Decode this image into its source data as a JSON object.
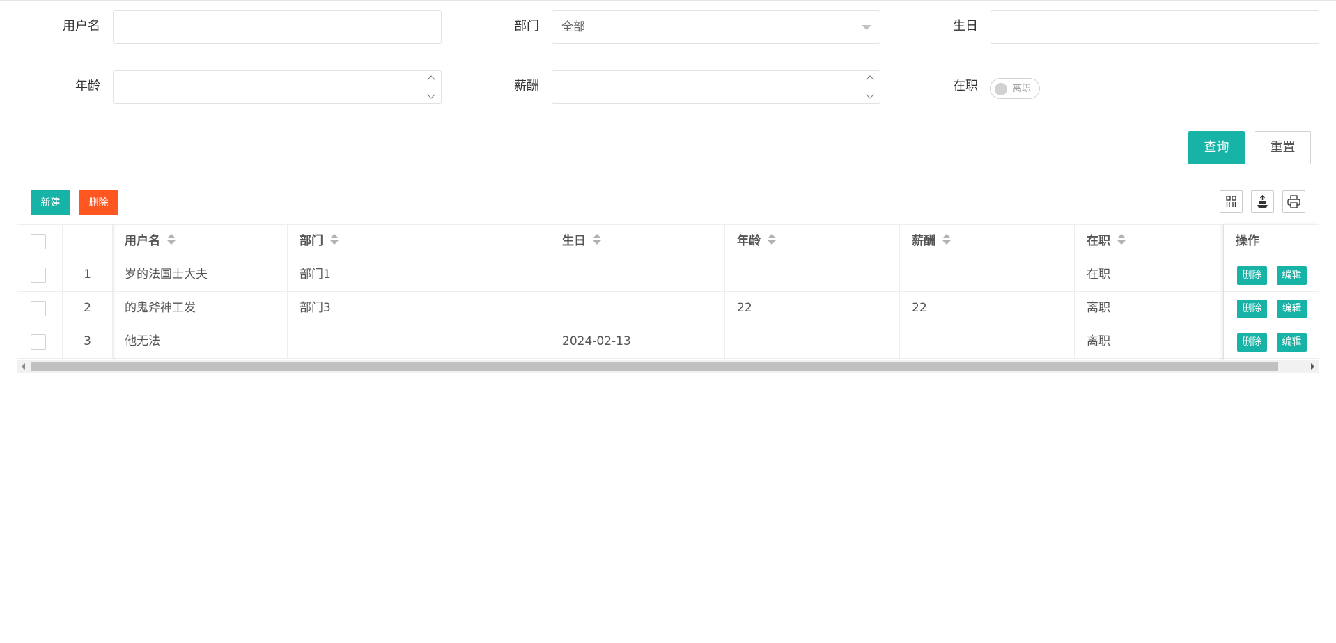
{
  "filters": {
    "username_label": "用户名",
    "username_value": "",
    "dept_label": "部门",
    "dept_value": "全部",
    "birthday_label": "生日",
    "birthday_value": "",
    "age_label": "年龄",
    "age_value": "",
    "salary_label": "薪酬",
    "salary_value": "",
    "employed_label": "在职",
    "employed_switch_text": "离职",
    "employed_on": false
  },
  "actions": {
    "query_label": "查询",
    "reset_label": "重置"
  },
  "toolbar": {
    "new_label": "新建",
    "delete_label": "删除",
    "icons": [
      "columns-icon",
      "export-icon",
      "print-icon"
    ]
  },
  "table": {
    "columns": [
      "用户名",
      "部门",
      "生日",
      "年龄",
      "薪酬",
      "在职",
      "操作"
    ],
    "rows": [
      {
        "index": "1",
        "username": "岁的法国士大夫",
        "dept": "部门1",
        "birthday": "",
        "age": "",
        "salary": "",
        "employed": "在职"
      },
      {
        "index": "2",
        "username": "的鬼斧神工发",
        "dept": "部门3",
        "birthday": "",
        "age": "22",
        "salary": "22",
        "employed": "离职"
      },
      {
        "index": "3",
        "username": "他无法",
        "dept": "",
        "birthday": "2024-02-13",
        "age": "",
        "salary": "",
        "employed": "离职"
      }
    ],
    "row_delete_label": "删除",
    "row_edit_label": "编辑"
  },
  "colors": {
    "primary": "#16b3a6",
    "danger": "#ff5722"
  }
}
